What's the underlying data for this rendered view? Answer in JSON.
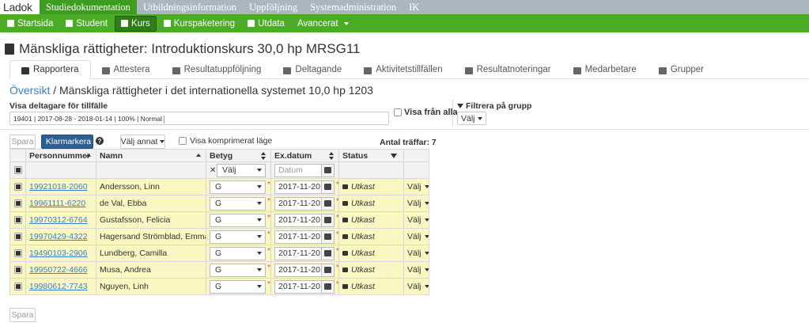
{
  "topbar": {
    "logo": "Ladok",
    "items": [
      {
        "label": "Studiedokumentation",
        "active": true
      },
      {
        "label": "Utbildningsinformation"
      },
      {
        "label": "Uppföljning"
      },
      {
        "label": "Systemadministration"
      },
      {
        "label": "IK"
      }
    ]
  },
  "nav": {
    "items": [
      {
        "label": "Startsida",
        "icon": "home-icon"
      },
      {
        "label": "Student",
        "icon": "user-icon"
      },
      {
        "label": "Kurs",
        "icon": "book-icon",
        "active": true
      },
      {
        "label": "Kurspaketering",
        "icon": "folder-icon"
      },
      {
        "label": "Utdata",
        "icon": "file-icon"
      },
      {
        "label": "Avancerat",
        "icon": "",
        "dropdown": true
      }
    ]
  },
  "page": {
    "title": "Mänskliga rättigheter: Introduktionskurs 30,0 hp MRSG11"
  },
  "tabs": [
    {
      "label": "Rapportera",
      "icon": "pencil-icon",
      "active": true
    },
    {
      "label": "Attestera",
      "icon": "list-icon"
    },
    {
      "label": "Resultatuppföljning",
      "icon": "bar-chart-icon"
    },
    {
      "label": "Deltagande",
      "icon": "person-icon"
    },
    {
      "label": "Aktivitetstillfällen",
      "icon": "calendar-icon"
    },
    {
      "label": "Resultatnoteringar",
      "icon": "tag-icon"
    },
    {
      "label": "Medarbetare",
      "icon": "link-icon"
    },
    {
      "label": "Grupper",
      "icon": "group-icon"
    }
  ],
  "breadcrumb": {
    "link": "Översikt",
    "separator": " / ",
    "current": "Mänskliga rättigheter i det internationella systemet 10,0 hp 1203"
  },
  "filters": {
    "visa_label": "Visa deltagare för tillfälle",
    "term_value": "19401 | 2017-08-28 - 2018-01-14 | 100% | Normal",
    "visa_alla_label": "Visa från alla",
    "filter_group_label": "Filtrera på grupp",
    "filter_group_value": "Välj"
  },
  "toolbar": {
    "save_label": "Spara",
    "klarmarkera_label": "Klarmarkera",
    "help_glyph": "?",
    "valj_annat_label": "Välj annat",
    "visa_komprimerat_label": "Visa komprimerat läge",
    "antal_traffar": "Antal träffar: 7"
  },
  "table": {
    "columns": [
      "Personnummer",
      "Namn",
      "Betyg",
      "Ex.datum",
      "Status"
    ],
    "filter_row": {
      "betyg_placeholder": "Välj",
      "datum_placeholder": "Datum"
    },
    "rows": [
      {
        "pnr": "19921018-2060",
        "name": "Andersson, Linn",
        "grade": "G",
        "date": "2017-11-20",
        "status": "Utkast",
        "action": "Välj"
      },
      {
        "pnr": "19961111-6220",
        "name": "de Val, Ebba",
        "grade": "G",
        "date": "2017-11-20",
        "status": "Utkast",
        "action": "Välj"
      },
      {
        "pnr": "19970312-6764",
        "name": "Gustafsson, Felicia",
        "grade": "G",
        "date": "2017-11-20",
        "status": "Utkast",
        "action": "Välj"
      },
      {
        "pnr": "19970429-4322",
        "name": "Hagersand Strömblad, Emma",
        "grade": "G",
        "date": "2017-11-20",
        "status": "Utkast",
        "action": "Välj"
      },
      {
        "pnr": "19490103-2906",
        "name": "Lundberg, Camilla",
        "grade": "G",
        "date": "2017-11-20",
        "status": "Utkast",
        "action": "Välj"
      },
      {
        "pnr": "19950722-4666",
        "name": "Musa, Andrea",
        "grade": "G",
        "date": "2017-11-20",
        "status": "Utkast",
        "action": "Välj"
      },
      {
        "pnr": "19980612-7743",
        "name": "Nguyen, Linh",
        "grade": "G",
        "date": "2017-11-20",
        "status": "Utkast",
        "action": "Välj"
      }
    ]
  },
  "footer": {
    "save_label": "Spara"
  },
  "colors": {
    "topbar": "#aab6c0",
    "green_nav": "#4bac26",
    "primary_button": "#2c5e91",
    "link": "#3a7fc1",
    "row_highlight": "#fbf7c2"
  }
}
